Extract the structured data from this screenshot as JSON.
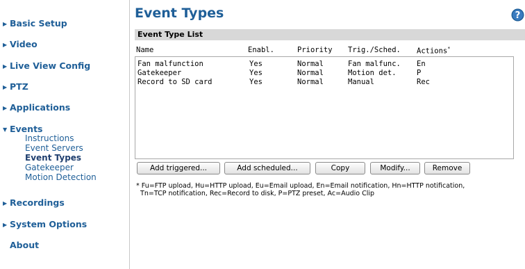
{
  "sidebar": {
    "items": [
      {
        "label": "Basic Setup"
      },
      {
        "label": "Video"
      },
      {
        "label": "Live View Config"
      },
      {
        "label": "PTZ"
      },
      {
        "label": "Applications"
      },
      {
        "label": "Events"
      },
      {
        "label": "Recordings"
      },
      {
        "label": "System Options"
      },
      {
        "label": "About"
      }
    ],
    "events_sub": [
      {
        "label": "Instructions"
      },
      {
        "label": "Event Servers"
      },
      {
        "label": "Event Types"
      },
      {
        "label": "Gatekeeper"
      },
      {
        "label": "Motion Detection"
      }
    ],
    "collapsed_glyph": "▶",
    "expanded_glyph": "▼"
  },
  "page": {
    "title": "Event Types",
    "help_icon": "question-circle-icon"
  },
  "list": {
    "header": "Event Type List",
    "columns": [
      "Name",
      "Enabl.",
      "Priority",
      "Trig./Sched.",
      "Actions"
    ],
    "actions_marker": "*",
    "rows": [
      [
        "Fan malfunction",
        "Yes",
        "Normal",
        "Fan malfunc.",
        "En"
      ],
      [
        "Gatekeeper",
        "Yes",
        "Normal",
        "Motion det.",
        "P"
      ],
      [
        "Record to SD card",
        "Yes",
        "Normal",
        "Manual",
        "Rec"
      ]
    ]
  },
  "buttons": {
    "add_triggered": "Add triggered...",
    "add_scheduled": "Add scheduled...",
    "copy": "Copy",
    "modify": "Modify...",
    "remove": "Remove"
  },
  "legend": {
    "line1": "* Fu=FTP upload, Hu=HTTP upload, Eu=Email upload, En=Email notification, Hn=HTTP notification,",
    "line2": "  Tn=TCP notification, Rec=Record to disk, P=PTZ preset, Ac=Audio Clip"
  },
  "colors": {
    "link": "#1f5f98",
    "header_bar": "#d8d8d8",
    "help_icon": "#1f5f98"
  }
}
